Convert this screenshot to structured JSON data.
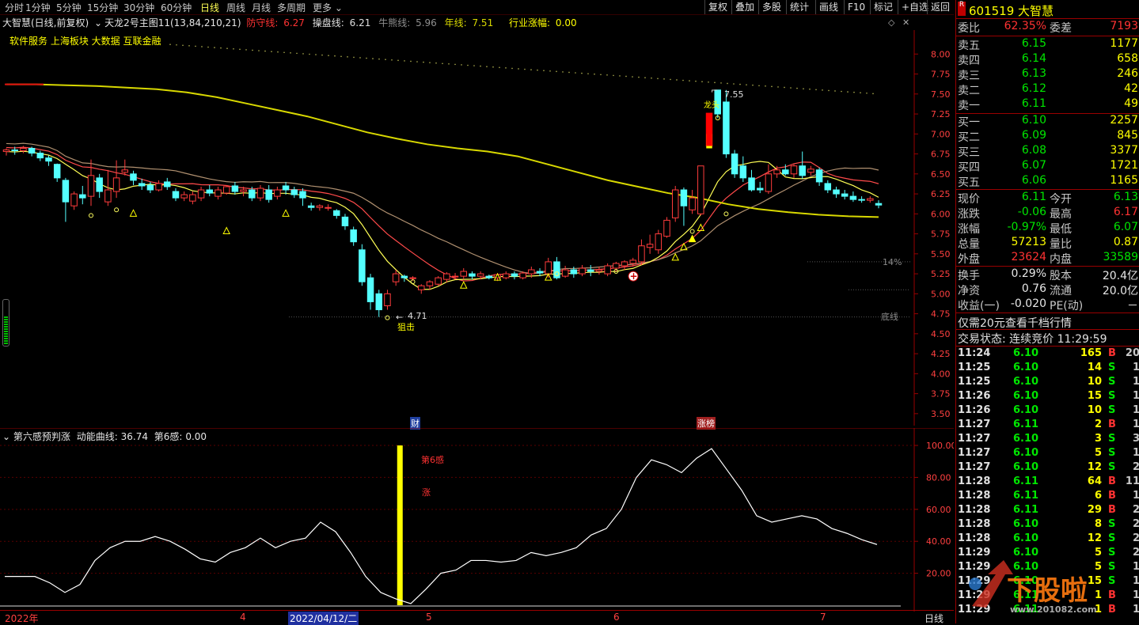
{
  "periods": [
    "分时",
    "1分钟",
    "5分钟",
    "15分钟",
    "30分钟",
    "60分钟",
    "日线",
    "周线",
    "月线",
    "多周期",
    "更多"
  ],
  "active_period": "日线",
  "toolbar": [
    "复权",
    "叠加",
    "多股",
    "统计",
    "画线",
    "F10",
    "标记",
    "+自选",
    "返回"
  ],
  "info": {
    "title": "大智慧(日线,前复权)",
    "formula": "天龙2号主图11(13,84,210,21)",
    "defense_label": "防守线:",
    "defense_value": "6.27",
    "trade_label": "操盘线:",
    "trade_value": "6.21",
    "bull_label": "牛熊线:",
    "bull_value": "5.96",
    "year_label": "年线:",
    "year_value": "7.51",
    "industry_label": "行业涨幅:",
    "industry_value": "0.00"
  },
  "sectors": "软件服务 上海板块 大数据 互联金融",
  "chart_labels": {
    "high": "7.55",
    "high_tag": "龙头",
    "low": "4.71",
    "low_tag": "狙击",
    "pct": "14%",
    "bottom": "底线",
    "fin_marker": "财",
    "zt_marker": "涨榜"
  },
  "indicator": {
    "name": "第六感预判涨",
    "curve_label": "动能曲线:",
    "curve_value": "36.74",
    "sense_label": "第6感:",
    "sense_value": "0.00",
    "bar_label1": "第6感",
    "bar_label2": "涨"
  },
  "xaxis": [
    "2022年",
    "4",
    "2022/04/12/二",
    "5",
    "6",
    "7"
  ],
  "xaxis_mode": "日线",
  "chart_data": {
    "type": "candlestick",
    "y_ticks": [
      3.5,
      3.75,
      4.0,
      4.25,
      4.5,
      4.75,
      5.0,
      5.25,
      5.5,
      5.75,
      6.0,
      6.25,
      6.5,
      6.75,
      7.0,
      7.25,
      7.5,
      7.75,
      8.0
    ],
    "ylim": [
      3.35,
      8.3
    ],
    "sub_y_ticks": [
      20.0,
      40.0,
      60.0,
      80.0,
      100.0
    ],
    "sub_ylim": [
      0,
      102
    ],
    "candles": [
      [
        6.78,
        6.8,
        6.73,
        6.82
      ],
      [
        6.8,
        6.79,
        6.74,
        6.84
      ],
      [
        6.79,
        6.82,
        6.76,
        6.85
      ],
      [
        6.82,
        6.76,
        6.72,
        6.84
      ],
      [
        6.76,
        6.7,
        6.66,
        6.79
      ],
      [
        6.7,
        6.66,
        6.6,
        6.73
      ],
      [
        6.62,
        6.45,
        6.4,
        6.63
      ],
      [
        6.42,
        6.15,
        5.9,
        6.45
      ],
      [
        6.1,
        6.25,
        6.05,
        6.28
      ],
      [
        6.24,
        6.2,
        6.12,
        6.35
      ],
      [
        6.22,
        6.48,
        6.1,
        6.68
      ],
      [
        6.45,
        6.28,
        6.2,
        6.5
      ],
      [
        6.15,
        6.3,
        6.1,
        6.55
      ],
      [
        6.28,
        6.45,
        6.2,
        6.67
      ],
      [
        6.52,
        6.55,
        6.48,
        6.68
      ],
      [
        6.5,
        6.42,
        6.36,
        6.54
      ],
      [
        6.38,
        6.35,
        6.3,
        6.44
      ],
      [
        6.36,
        6.3,
        6.26,
        6.4
      ],
      [
        6.3,
        6.38,
        6.28,
        6.42
      ],
      [
        6.4,
        6.34,
        6.3,
        6.45
      ],
      [
        6.28,
        6.2,
        6.16,
        6.32
      ],
      [
        6.2,
        6.24,
        6.16,
        6.28
      ],
      [
        6.16,
        6.24,
        6.12,
        6.28
      ],
      [
        6.2,
        6.3,
        6.16,
        6.34
      ],
      [
        6.3,
        6.26,
        6.22,
        6.36
      ],
      [
        6.22,
        6.3,
        6.18,
        6.34
      ],
      [
        6.26,
        6.34,
        6.24,
        6.36
      ],
      [
        6.35,
        6.28,
        6.24,
        6.4
      ],
      [
        6.28,
        6.3,
        6.22,
        6.34
      ],
      [
        6.3,
        6.2,
        6.16,
        6.34
      ],
      [
        6.2,
        6.32,
        6.16,
        6.36
      ],
      [
        6.3,
        6.18,
        6.14,
        6.36
      ],
      [
        6.22,
        6.3,
        6.18,
        6.34
      ],
      [
        6.35,
        6.3,
        6.24,
        6.4
      ],
      [
        6.3,
        6.24,
        6.2,
        6.34
      ],
      [
        6.28,
        6.2,
        6.1,
        6.32
      ],
      [
        6.1,
        6.08,
        6.04,
        6.14
      ],
      [
        6.08,
        6.1,
        6.04,
        6.12
      ],
      [
        6.08,
        6.08,
        6.04,
        6.12
      ],
      [
        6.04,
        5.98,
        5.94,
        6.06
      ],
      [
        5.96,
        5.85,
        5.8,
        6.0
      ],
      [
        5.8,
        5.65,
        5.6,
        5.84
      ],
      [
        5.55,
        5.15,
        5.1,
        5.62
      ],
      [
        5.2,
        4.9,
        4.8,
        5.25
      ],
      [
        5.0,
        4.8,
        4.71,
        5.05
      ],
      [
        4.85,
        5.0,
        4.8,
        5.05
      ],
      [
        5.15,
        5.25,
        5.1,
        5.3
      ],
      [
        5.22,
        5.2,
        5.15,
        5.24
      ],
      [
        5.2,
        5.2,
        5.16,
        5.22
      ],
      [
        5.05,
        5.1,
        5.0,
        5.12
      ],
      [
        5.1,
        5.15,
        5.05,
        5.17
      ],
      [
        5.12,
        5.2,
        5.1,
        5.22
      ],
      [
        5.18,
        5.25,
        5.14,
        5.27
      ],
      [
        5.22,
        5.22,
        5.18,
        5.26
      ],
      [
        5.22,
        5.28,
        5.18,
        5.32
      ],
      [
        5.25,
        5.22,
        5.18,
        5.28
      ],
      [
        5.22,
        5.25,
        5.18,
        5.28
      ],
      [
        5.22,
        5.2,
        5.18,
        5.24
      ],
      [
        5.2,
        5.24,
        5.16,
        5.26
      ],
      [
        5.2,
        5.25,
        5.18,
        5.28
      ],
      [
        5.25,
        5.22,
        5.18,
        5.28
      ],
      [
        5.2,
        5.26,
        5.18,
        5.28
      ],
      [
        5.25,
        5.3,
        5.2,
        5.34
      ],
      [
        5.28,
        5.26,
        5.22,
        5.32
      ],
      [
        5.25,
        5.4,
        5.2,
        5.45
      ],
      [
        5.4,
        5.2,
        5.18,
        5.46
      ],
      [
        5.22,
        5.3,
        5.2,
        5.35
      ],
      [
        5.3,
        5.25,
        5.2,
        5.34
      ],
      [
        5.25,
        5.32,
        5.22,
        5.36
      ],
      [
        5.3,
        5.28,
        5.22,
        5.36
      ],
      [
        5.28,
        5.3,
        5.24,
        5.34
      ],
      [
        5.25,
        5.35,
        5.22,
        5.38
      ],
      [
        5.32,
        5.38,
        5.28,
        5.4
      ],
      [
        5.35,
        5.4,
        5.3,
        5.42
      ],
      [
        5.38,
        5.42,
        5.34,
        5.45
      ],
      [
        5.4,
        5.6,
        5.36,
        5.68
      ],
      [
        5.58,
        5.62,
        5.5,
        5.74
      ],
      [
        5.55,
        5.75,
        5.5,
        5.8
      ],
      [
        5.72,
        5.92,
        5.7,
        5.96
      ],
      [
        5.95,
        6.3,
        5.9,
        6.35
      ],
      [
        6.3,
        6.1,
        5.85,
        6.33
      ],
      [
        6.05,
        6.2,
        6.0,
        6.3
      ],
      [
        6.0,
        6.6,
        5.98,
        6.6
      ],
      [
        6.85,
        7.26,
        6.85,
        7.26
      ],
      [
        7.55,
        7.25,
        7.2,
        7.55
      ],
      [
        7.4,
        6.75,
        6.7,
        7.55
      ],
      [
        6.75,
        6.5,
        6.45,
        6.8
      ],
      [
        6.6,
        6.45,
        6.4,
        6.72
      ],
      [
        6.45,
        6.3,
        6.28,
        6.55
      ],
      [
        6.32,
        6.3,
        6.26,
        6.4
      ],
      [
        6.28,
        6.5,
        6.25,
        6.62
      ],
      [
        6.5,
        6.55,
        6.45,
        6.6
      ],
      [
        6.55,
        6.5,
        6.48,
        6.62
      ],
      [
        6.5,
        6.6,
        6.45,
        6.62
      ],
      [
        6.6,
        6.48,
        6.44,
        6.78
      ],
      [
        6.52,
        6.56,
        6.48,
        6.6
      ],
      [
        6.55,
        6.4,
        6.35,
        6.58
      ],
      [
        6.38,
        6.3,
        6.26,
        6.42
      ],
      [
        6.3,
        6.25,
        6.2,
        6.34
      ],
      [
        6.25,
        6.22,
        6.18,
        6.3
      ],
      [
        6.22,
        6.18,
        6.15,
        6.28
      ],
      [
        6.18,
        6.17,
        6.14,
        6.22
      ],
      [
        6.17,
        6.19,
        6.14,
        6.22
      ],
      [
        6.13,
        6.11,
        6.07,
        6.17
      ]
    ],
    "year_line": [
      7.62,
      7.62,
      7.61,
      7.6,
      7.58,
      7.56,
      7.52,
      7.46,
      7.38,
      7.3,
      7.22,
      7.12,
      7.02,
      6.94,
      6.87,
      6.82,
      6.78,
      6.72,
      6.62,
      6.52,
      6.42,
      6.34,
      6.26,
      6.2,
      6.12,
      6.06,
      6.02,
      5.99,
      5.97,
      5.96
    ],
    "sub_curve": [
      18,
      18,
      18,
      14,
      8,
      13,
      28,
      36,
      40,
      40,
      43,
      40,
      35,
      29,
      27,
      33,
      36,
      42,
      36,
      40,
      42,
      52,
      46,
      33,
      18,
      8,
      4,
      1,
      10,
      20,
      22,
      28,
      28,
      27,
      28,
      33,
      31,
      33,
      36,
      44,
      48,
      60,
      80,
      91,
      88,
      83,
      92,
      98,
      85,
      72,
      56,
      52,
      54,
      56,
      54,
      48,
      45,
      41,
      38
    ],
    "sense_bar_index": 44
  },
  "quote": {
    "badge": "R",
    "code": "601519",
    "name": "大智慧",
    "weibi_label": "委比",
    "weibi": "62.35%",
    "weicha_label": "委差",
    "weicha": "7193",
    "asks": [
      [
        "卖五",
        "6.15",
        "1177"
      ],
      [
        "卖四",
        "6.14",
        "658"
      ],
      [
        "卖三",
        "6.13",
        "246"
      ],
      [
        "卖二",
        "6.12",
        "42"
      ],
      [
        "卖一",
        "6.11",
        "49"
      ]
    ],
    "bids": [
      [
        "买一",
        "6.10",
        "2257"
      ],
      [
        "买二",
        "6.09",
        "845"
      ],
      [
        "买三",
        "6.08",
        "3377"
      ],
      [
        "买四",
        "6.07",
        "1721"
      ],
      [
        "买五",
        "6.06",
        "1165"
      ]
    ],
    "stats": [
      [
        "现价",
        "6.11",
        "今开",
        "6.13"
      ],
      [
        "涨跌",
        "-0.06",
        "最高",
        "6.17"
      ],
      [
        "涨幅",
        "-0.97%",
        "最低",
        "6.07"
      ],
      [
        "总量",
        "57213",
        "量比",
        "0.87"
      ],
      [
        "外盘",
        "23624",
        "内盘",
        "33589"
      ]
    ],
    "stats2": [
      [
        "换手",
        "0.29%",
        "股本",
        "20.4亿"
      ],
      [
        "净资",
        "0.76",
        "流通",
        "20.0亿"
      ],
      [
        "收益(一)",
        "-0.020",
        "PE(动)",
        "－"
      ]
    ],
    "promo": "仅需20元查看千档行情",
    "status": "交易状态: 连续竞价 11:29:59",
    "ticks": [
      [
        "11:24",
        "6.10",
        "165",
        "B",
        "20"
      ],
      [
        "11:25",
        "6.10",
        "14",
        "S",
        "1"
      ],
      [
        "11:25",
        "6.10",
        "10",
        "S",
        "1"
      ],
      [
        "11:26",
        "6.10",
        "15",
        "S",
        "1"
      ],
      [
        "11:26",
        "6.10",
        "10",
        "S",
        "1"
      ],
      [
        "11:27",
        "6.11",
        "2",
        "B",
        "1"
      ],
      [
        "11:27",
        "6.10",
        "3",
        "S",
        "3"
      ],
      [
        "11:27",
        "6.10",
        "5",
        "S",
        "1"
      ],
      [
        "11:27",
        "6.10",
        "12",
        "S",
        "2"
      ],
      [
        "11:28",
        "6.11",
        "64",
        "B",
        "11"
      ],
      [
        "11:28",
        "6.11",
        "6",
        "B",
        "1"
      ],
      [
        "11:28",
        "6.11",
        "29",
        "B",
        "2"
      ],
      [
        "11:28",
        "6.10",
        "8",
        "S",
        "2"
      ],
      [
        "11:28",
        "6.10",
        "12",
        "S",
        "2"
      ],
      [
        "11:29",
        "6.10",
        "5",
        "S",
        "2"
      ],
      [
        "11:29",
        "6.10",
        "5",
        "S",
        "1"
      ],
      [
        "11:29",
        "6.10",
        "15",
        "S",
        "1"
      ],
      [
        "11:29",
        "6.11",
        "1",
        "B",
        "1"
      ],
      [
        "11:29",
        "6.11",
        "1",
        "B",
        "1"
      ]
    ]
  },
  "watermark": "www.201082.com"
}
